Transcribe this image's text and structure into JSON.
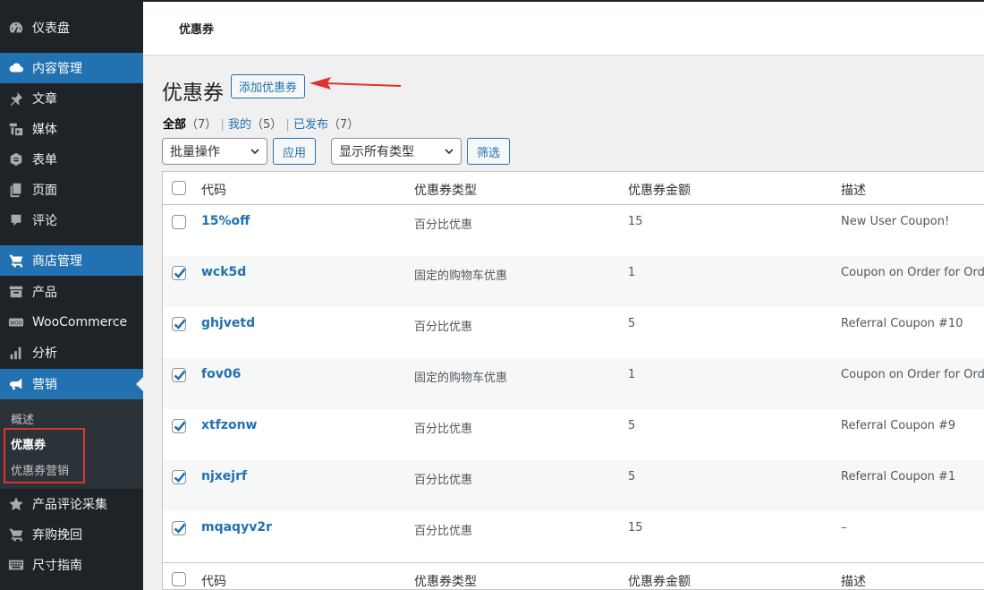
{
  "sidebar": {
    "items": [
      {
        "label": "仪表盘",
        "icon": "dashboard-icon"
      },
      {
        "label": "内容管理",
        "icon": "cloud-icon"
      },
      {
        "label": "文章",
        "icon": "pin-icon"
      },
      {
        "label": "媒体",
        "icon": "media-icon"
      },
      {
        "label": "表单",
        "icon": "form-icon"
      },
      {
        "label": "页面",
        "icon": "page-icon"
      },
      {
        "label": "评论",
        "icon": "comment-icon"
      },
      {
        "label": "商店管理",
        "icon": "cart-icon"
      },
      {
        "label": "产品",
        "icon": "archive-icon"
      },
      {
        "label": "WooCommerce",
        "icon": "woo-icon"
      },
      {
        "label": "分析",
        "icon": "chart-bar-icon"
      },
      {
        "label": "营销",
        "icon": "megaphone-icon"
      },
      {
        "label": "产品评论采集",
        "icon": "star-icon"
      },
      {
        "label": "弃购挽回",
        "icon": "cart-icon"
      },
      {
        "label": "尺寸指南",
        "icon": "keyboard-icon"
      }
    ],
    "submenu": [
      {
        "label": "概述"
      },
      {
        "label": "优惠券"
      },
      {
        "label": "优惠券营销"
      }
    ]
  },
  "topbar": {
    "title": "优惠券"
  },
  "page": {
    "title": "优惠券",
    "add_button": "添加优惠券"
  },
  "views": {
    "all": "全部",
    "all_count": "（7）",
    "mine": "我的",
    "mine_count": "（5）",
    "published": "已发布",
    "published_count": "（7）",
    "sep": "|"
  },
  "filters": {
    "bulk_action": "批量操作",
    "apply": "应用",
    "type_filter": "显示所有类型",
    "filter": "筛选"
  },
  "table": {
    "columns": [
      "代码",
      "优惠券类型",
      "优惠券金额",
      "描述"
    ],
    "rows": [
      {
        "code": "15%off",
        "type": "百分比优惠",
        "amount": "15",
        "desc": "New User Coupon!",
        "checked": false
      },
      {
        "code": "wck5d",
        "type": "固定的购物车优惠",
        "amount": "1",
        "desc": "Coupon on Order for OrderI",
        "checked": true
      },
      {
        "code": "ghjvetd",
        "type": "百分比优惠",
        "amount": "5",
        "desc": "Referral Coupon #10",
        "checked": true
      },
      {
        "code": "fov06",
        "type": "固定的购物车优惠",
        "amount": "1",
        "desc": "Coupon on Order for OrderI",
        "checked": true
      },
      {
        "code": "xtfzonw",
        "type": "百分比优惠",
        "amount": "5",
        "desc": "Referral Coupon #9",
        "checked": true
      },
      {
        "code": "njxejrf",
        "type": "百分比优惠",
        "amount": "5",
        "desc": "Referral Coupon #1",
        "checked": true
      },
      {
        "code": "mqaqyv2r",
        "type": "百分比优惠",
        "amount": "15",
        "desc": "–",
        "checked": true
      }
    ]
  },
  "colors": {
    "accent": "#2271b1",
    "sidebar_bg": "#1d2327",
    "annotation_red": "#d63638"
  }
}
